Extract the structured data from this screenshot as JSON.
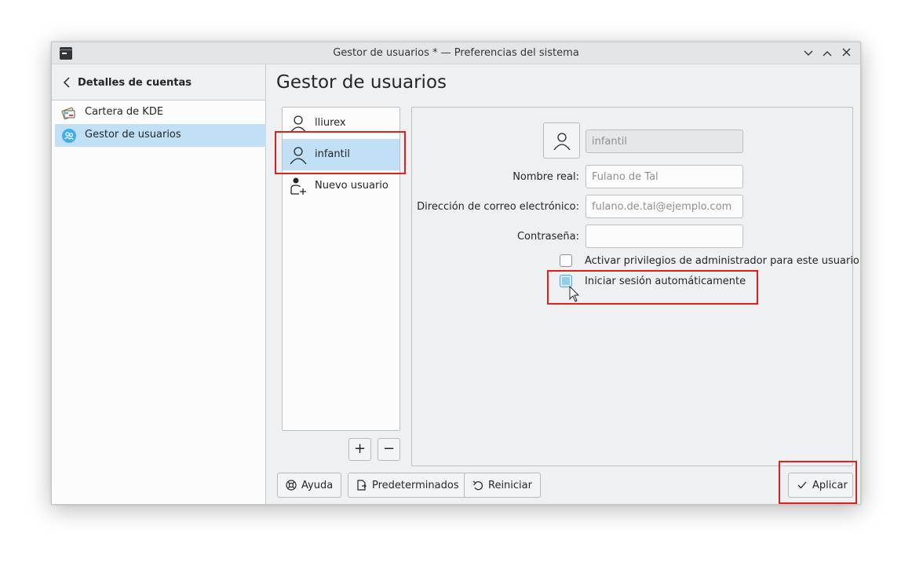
{
  "window": {
    "title": "Gestor de usuarios * — Preferencias del sistema",
    "controls": [
      "minimize",
      "maximize",
      "close"
    ]
  },
  "sidebar": {
    "back_label": "Detalles de cuentas",
    "items": [
      {
        "label": "Cartera de KDE",
        "icon": "wallet-icon",
        "selected": false
      },
      {
        "label": "Gestor de usuarios",
        "icon": "user-manager-icon",
        "selected": true
      }
    ]
  },
  "main": {
    "title": "Gestor de usuarios"
  },
  "users": {
    "items": [
      {
        "label": "lliurex",
        "icon": "user-icon",
        "selected": false
      },
      {
        "label": "infantil",
        "icon": "user-icon",
        "selected": true
      },
      {
        "label": "Nuevo usuario",
        "icon": "add-user-icon",
        "selected": false
      }
    ],
    "add_label": "+",
    "remove_label": "−"
  },
  "details": {
    "username": "infantil",
    "real_name": {
      "label": "Nombre real:",
      "placeholder": "Fulano de Tal",
      "value": ""
    },
    "email": {
      "label": "Dirección de correo electrónico:",
      "placeholder": "fulano.de.tal@ejemplo.com",
      "value": ""
    },
    "password": {
      "label": "Contraseña:",
      "value": ""
    },
    "admin_checkbox": {
      "label": "Activar privilegios de administrador para este usuario",
      "checked": false
    },
    "autologin_checkbox": {
      "label": "Iniciar sesión automáticamente",
      "checked": false,
      "focused": true
    }
  },
  "buttons": {
    "help": "Ayuda",
    "defaults": "Predeterminados",
    "reset": "Reiniciar",
    "apply": "Aplicar"
  },
  "colors": {
    "selection": "#c2e0f5",
    "highlight_box": "#e02020",
    "accent": "#3daee9"
  }
}
